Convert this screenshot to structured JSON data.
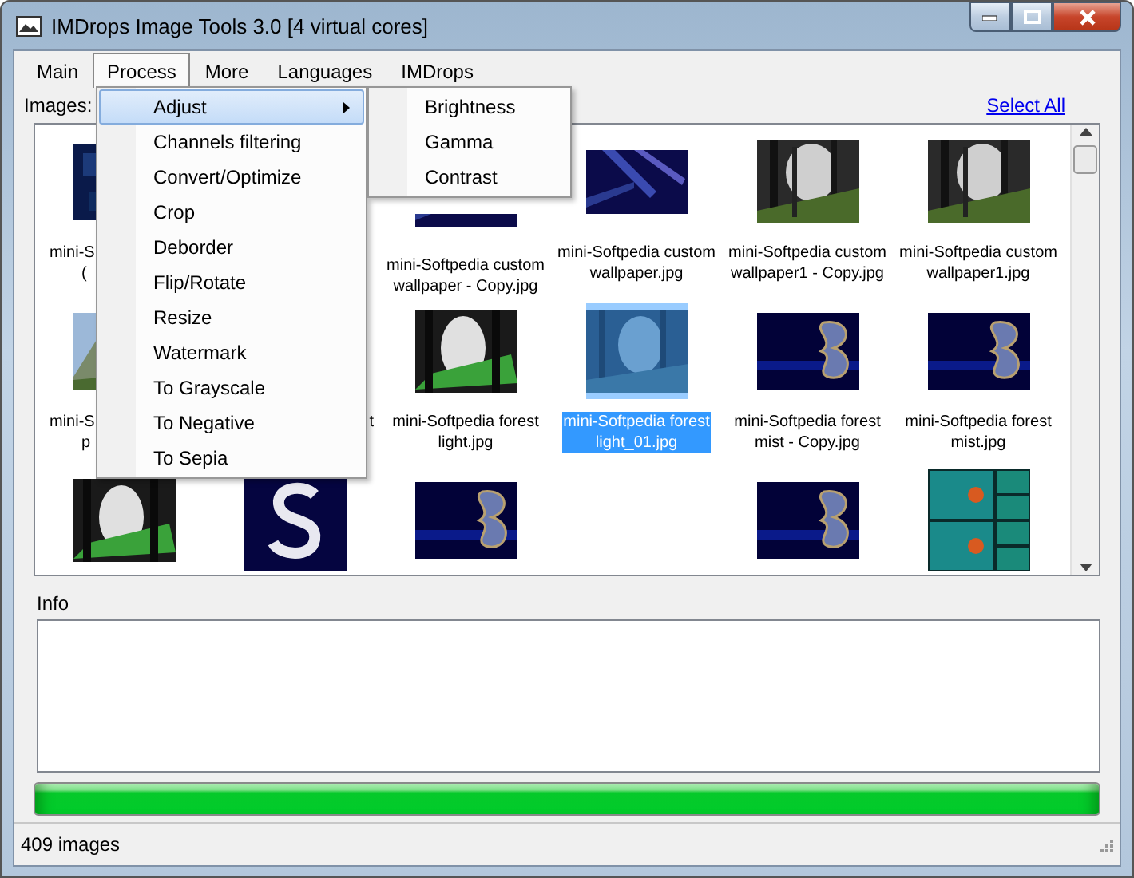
{
  "window": {
    "title": "IMDrops Image Tools 3.0 [4 virtual cores]"
  },
  "menu_bar": [
    {
      "label": "Main",
      "selected": false
    },
    {
      "label": "Process",
      "selected": true
    },
    {
      "label": "More",
      "selected": false
    },
    {
      "label": "Languages",
      "selected": false
    },
    {
      "label": "IMDrops",
      "selected": false
    }
  ],
  "process_menu": [
    {
      "label": "Adjust",
      "selected": true,
      "has_submenu": true
    },
    {
      "label": "Channels filtering",
      "selected": false,
      "has_submenu": false
    },
    {
      "label": "Convert/Optimize",
      "selected": false,
      "has_submenu": false
    },
    {
      "label": "Crop",
      "selected": false,
      "has_submenu": false
    },
    {
      "label": "Deborder",
      "selected": false,
      "has_submenu": false
    },
    {
      "label": "Flip/Rotate",
      "selected": false,
      "has_submenu": false
    },
    {
      "label": "Resize",
      "selected": false,
      "has_submenu": false
    },
    {
      "label": "Watermark",
      "selected": false,
      "has_submenu": false
    },
    {
      "label": "To Grayscale",
      "selected": false,
      "has_submenu": false
    },
    {
      "label": "To Negative",
      "selected": false,
      "has_submenu": false
    },
    {
      "label": "To Sepia",
      "selected": false,
      "has_submenu": false
    }
  ],
  "adjust_submenu": [
    {
      "label": "Brightness",
      "selected": false
    },
    {
      "label": "Gamma",
      "selected": false
    },
    {
      "label": "Contrast",
      "selected": false
    }
  ],
  "images_label": "Images:",
  "select_all": "Select All",
  "images": [
    {
      "kind": "texture",
      "selected": false,
      "cut_left": false,
      "cut_right": true,
      "cut_top": false,
      "lines": [
        "mini-S",
        "("
      ]
    },
    {
      "kind": "empty"
    },
    {
      "kind": "swirl",
      "selected": false,
      "cut_left": false,
      "cut_right": false,
      "cut_top": true,
      "lines": [
        "mini-Softpedia custom",
        "wallpaper - Copy.jpg"
      ]
    },
    {
      "kind": "swirl",
      "selected": false,
      "cut_left": false,
      "cut_right": false,
      "cut_top": false,
      "lines": [
        "mini-Softpedia custom",
        "wallpaper.jpg"
      ]
    },
    {
      "kind": "forest",
      "selected": false,
      "cut_left": false,
      "cut_right": false,
      "cut_top": false,
      "lines": [
        "mini-Softpedia custom",
        "wallpaper1 - Copy.jpg"
      ]
    },
    {
      "kind": "forest",
      "selected": false,
      "cut_left": false,
      "cut_right": false,
      "cut_top": false,
      "lines": [
        "mini-Softpedia custom",
        "wallpaper1.jpg"
      ]
    },
    {
      "kind": "mountain",
      "selected": false,
      "cut_left": false,
      "cut_right": true,
      "cut_top": false,
      "lines": [
        "mini-S",
        "p"
      ]
    },
    {
      "kind": "empty",
      "selected": false,
      "cut_left": true,
      "cut_right": false,
      "lines": [
        "t"
      ]
    },
    {
      "kind": "forest-green",
      "selected": false,
      "cut_left": false,
      "cut_right": false,
      "cut_top": false,
      "lines": [
        "mini-Softpedia forest",
        "light.jpg"
      ]
    },
    {
      "kind": "forest-blue",
      "selected": true,
      "cut_left": false,
      "cut_right": false,
      "cut_top": false,
      "lines": [
        "mini-Softpedia forest",
        "light_01.jpg"
      ]
    },
    {
      "kind": "butterfly",
      "selected": false,
      "cut_left": false,
      "cut_right": false,
      "cut_top": false,
      "lines": [
        "mini-Softpedia forest",
        "mist - Copy.jpg"
      ]
    },
    {
      "kind": "butterfly",
      "selected": false,
      "cut_left": false,
      "cut_right": false,
      "cut_top": false,
      "lines": [
        "mini-Softpedia forest",
        "mist.jpg"
      ]
    },
    {
      "kind": "forest-green",
      "selected": false,
      "cut_left": false,
      "cut_right": false,
      "cut_top": false
    },
    {
      "kind": "letter",
      "selected": false,
      "cut_left": false,
      "cut_right": false,
      "cut_top": false
    },
    {
      "kind": "butterfly",
      "selected": false,
      "cut_left": false,
      "cut_right": false,
      "cut_top": false
    },
    {
      "kind": "empty"
    },
    {
      "kind": "butterfly",
      "selected": false,
      "cut_left": false,
      "cut_right": false,
      "cut_top": false
    },
    {
      "kind": "collage",
      "selected": false,
      "cut_left": false,
      "cut_right": false,
      "cut_top": false
    }
  ],
  "info_label": "Info",
  "progress": {
    "level": 1
  },
  "status_bar": "409 images"
}
